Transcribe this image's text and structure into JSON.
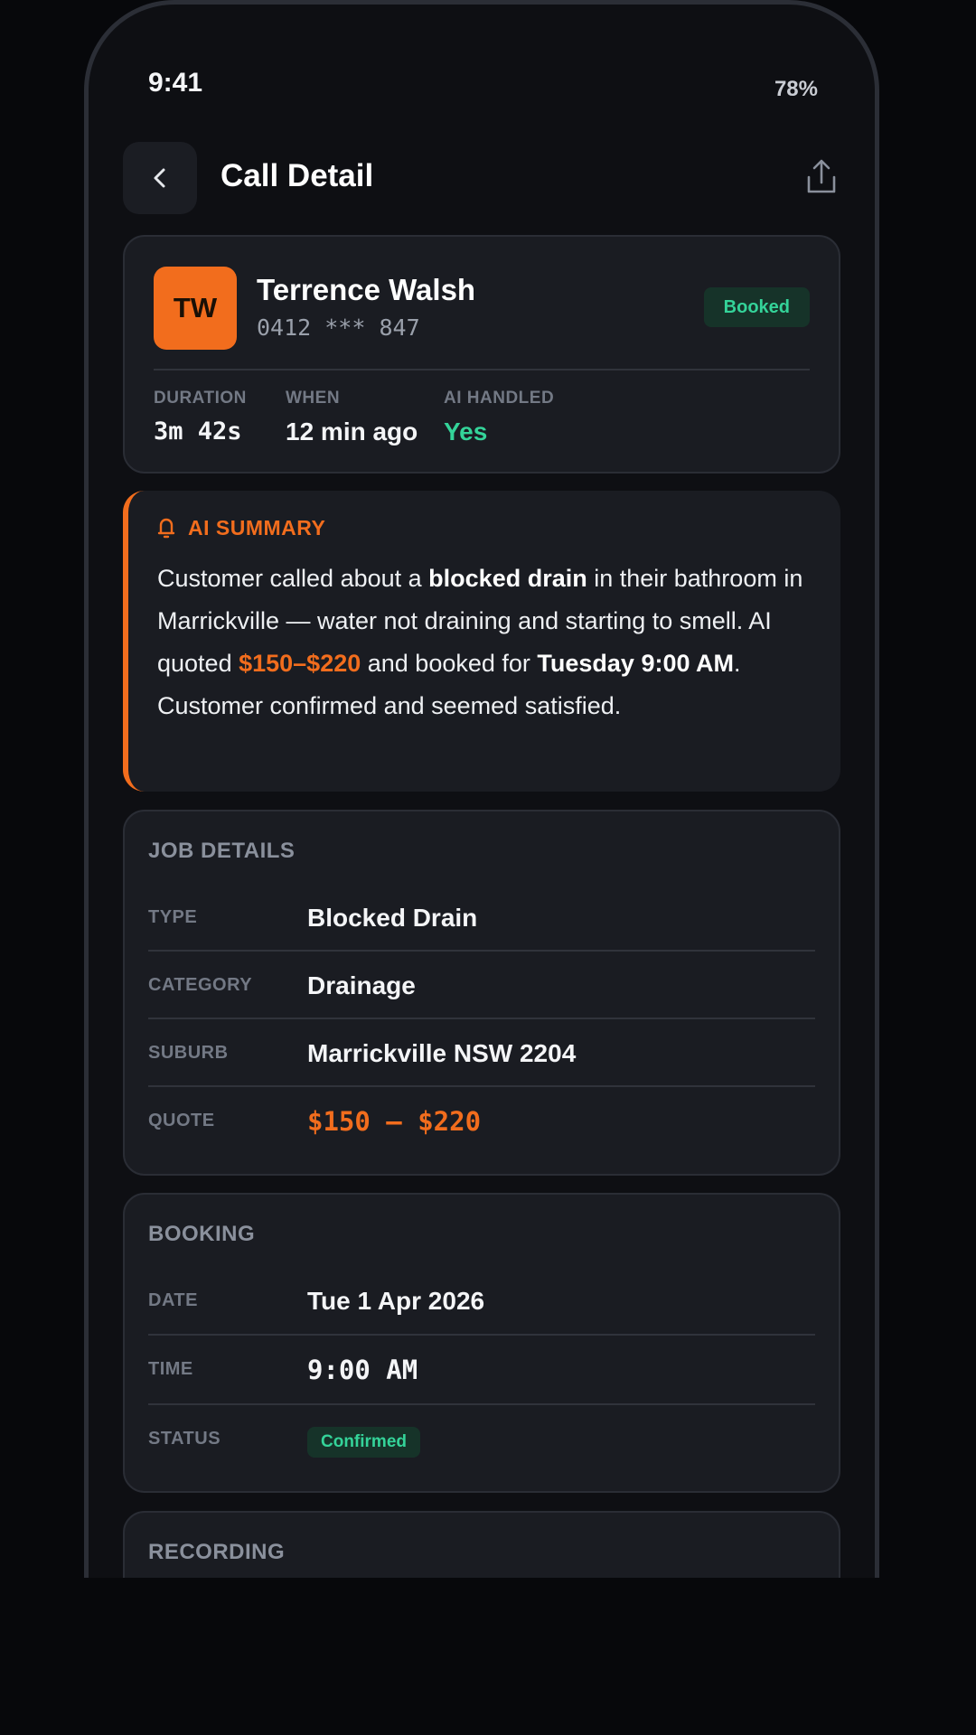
{
  "status_bar": {
    "time": "9:41",
    "battery": "78%"
  },
  "header": {
    "title": "Call Detail"
  },
  "caller": {
    "initials": "TW",
    "name": "Terrence Walsh",
    "phone": "0412 *** 847",
    "badge": "Booked",
    "stats": [
      {
        "label": "DURATION",
        "value": "3m 42s"
      },
      {
        "label": "WHEN",
        "value": "12 min ago"
      },
      {
        "label": "AI HANDLED",
        "value": "Yes"
      }
    ]
  },
  "summary": {
    "title": "AI SUMMARY",
    "parts": [
      "Customer called about a ",
      "blocked drain",
      " in their bathroom in Marrickville — water not draining and starting to smell. AI quoted ",
      "$150–$220",
      " and booked for ",
      "Tuesday 9:00 AM",
      ". Customer confirmed and seemed satisfied."
    ]
  },
  "job_details": {
    "title": "JOB DETAILS",
    "rows": [
      {
        "label": "TYPE",
        "value": "Blocked Drain"
      },
      {
        "label": "CATEGORY",
        "value": "Drainage"
      },
      {
        "label": "SUBURB",
        "value": "Marrickville NSW 2204"
      },
      {
        "label": "QUOTE",
        "value": "$150 – $220"
      }
    ]
  },
  "booking": {
    "title": "BOOKING",
    "rows": [
      {
        "label": "DATE",
        "value": "Tue 1 Apr 2026"
      },
      {
        "label": "TIME",
        "value": "9:00 AM"
      },
      {
        "label": "STATUS",
        "value": "Confirmed"
      }
    ]
  },
  "recording": {
    "title": "RECORDING"
  },
  "colors": {
    "accent": "#f26d1d",
    "success": "#34d399",
    "background": "#0e0f13",
    "card": "#1a1c22"
  }
}
